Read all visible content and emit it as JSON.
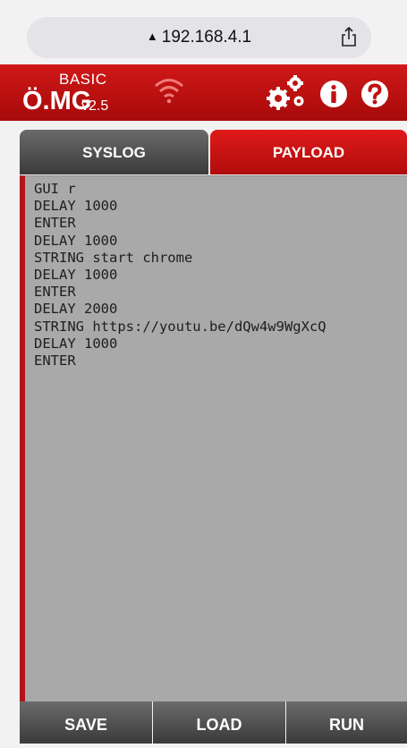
{
  "browser": {
    "url": "192.168.4.1",
    "lock_icon": "lock-icon",
    "share_icon": "share-icon"
  },
  "header": {
    "logo_small": "BASIC",
    "logo_main": "Ö.MG",
    "version": "v2.5",
    "icons": [
      "wifi-icon",
      "settings-gears-icon",
      "info-icon",
      "help-icon"
    ],
    "brand_color": "#c81414"
  },
  "tabs": [
    {
      "label": "SYSLOG",
      "active": false
    },
    {
      "label": "PAYLOAD",
      "active": true
    }
  ],
  "payload": {
    "text": "GUI r\nDELAY 1000\nENTER\nDELAY 1000\nSTRING start chrome\nDELAY 1000\nENTER\nDELAY 2000\nSTRING https://youtu.be/dQw4w9WgXcQ\nDELAY 1000\nENTER"
  },
  "footer": {
    "save_label": "SAVE",
    "load_label": "LOAD",
    "run_label": "RUN"
  }
}
